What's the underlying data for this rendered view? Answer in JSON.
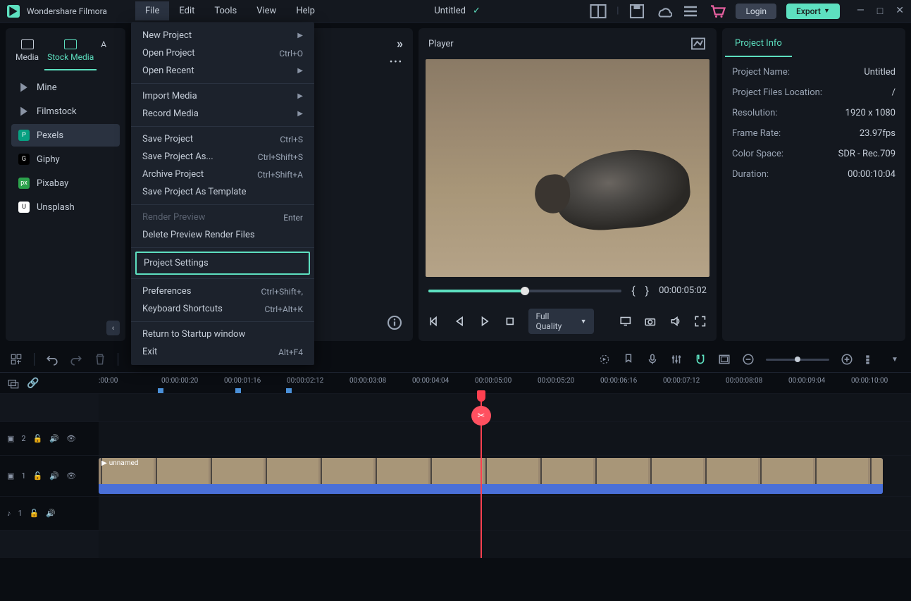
{
  "app": {
    "name": "Wondershare Filmora",
    "doc_title": "Untitled"
  },
  "menubar": [
    "File",
    "Edit",
    "Tools",
    "View",
    "Help"
  ],
  "titlebar": {
    "login": "Login",
    "export": "Export"
  },
  "tabs": {
    "media": "Media",
    "stock": "Stock Media"
  },
  "side_items": [
    {
      "label": "Mine",
      "icon": "play"
    },
    {
      "label": "Filmstock",
      "icon": "play"
    },
    {
      "label": "Pexels",
      "icon": "P",
      "color": "#07a081"
    },
    {
      "label": "Giphy",
      "icon": "G",
      "color": "#000"
    },
    {
      "label": "Pixabay",
      "icon": "px",
      "color": "#2ca24c"
    },
    {
      "label": "Unsplash",
      "icon": "U",
      "color": "#fff"
    }
  ],
  "file_menu": [
    {
      "label": "New Project",
      "sub": true
    },
    {
      "label": "Open Project",
      "shortcut": "Ctrl+O"
    },
    {
      "label": "Open Recent",
      "sub": true
    },
    {
      "sep": true
    },
    {
      "label": "Import Media",
      "sub": true
    },
    {
      "label": "Record Media",
      "sub": true
    },
    {
      "sep": true
    },
    {
      "label": "Save Project",
      "shortcut": "Ctrl+S"
    },
    {
      "label": "Save Project As...",
      "shortcut": "Ctrl+Shift+S"
    },
    {
      "label": "Archive Project",
      "shortcut": "Ctrl+Shift+A"
    },
    {
      "label": "Save Project As Template"
    },
    {
      "sep": true
    },
    {
      "label": "Render Preview",
      "shortcut": "Enter",
      "disabled": true
    },
    {
      "label": "Delete Preview Render Files"
    },
    {
      "sep": true
    },
    {
      "label": "Project Settings",
      "highlight": true
    },
    {
      "sep": true
    },
    {
      "label": "Preferences",
      "shortcut": "Ctrl+Shift+,"
    },
    {
      "label": "Keyboard Shortcuts",
      "shortcut": "Ctrl+Alt+K"
    },
    {
      "sep": true
    },
    {
      "label": "Return to Startup window"
    },
    {
      "label": "Exit",
      "shortcut": "Alt+F4"
    }
  ],
  "player": {
    "title": "Player",
    "time": "00:00:05:02",
    "quality": "Full Quality"
  },
  "info": {
    "tab": "Project Info",
    "rows": [
      {
        "k": "Project Name:",
        "v": "Untitled"
      },
      {
        "k": "Project Files Location:",
        "v": "/"
      },
      {
        "k": "Resolution:",
        "v": "1920 x 1080"
      },
      {
        "k": "Frame Rate:",
        "v": "23.97fps"
      },
      {
        "k": "Color Space:",
        "v": "SDR - Rec.709"
      },
      {
        "k": "Duration:",
        "v": "00:00:10:04"
      }
    ]
  },
  "ruler": [
    ":00:00",
    "00:00:00:20",
    "00:00:01:16",
    "00:00:02:12",
    "00:00:03:08",
    "00:00:04:04",
    "00:00:05:00",
    "00:00:05:20",
    "00:00:06:16",
    "00:00:07:12",
    "00:00:08:08",
    "00:00:09:04",
    "00:00:10:00"
  ],
  "tracks": {
    "fx": "2",
    "vid": "1",
    "aud": "1"
  },
  "clip": {
    "name": "unnamed"
  }
}
